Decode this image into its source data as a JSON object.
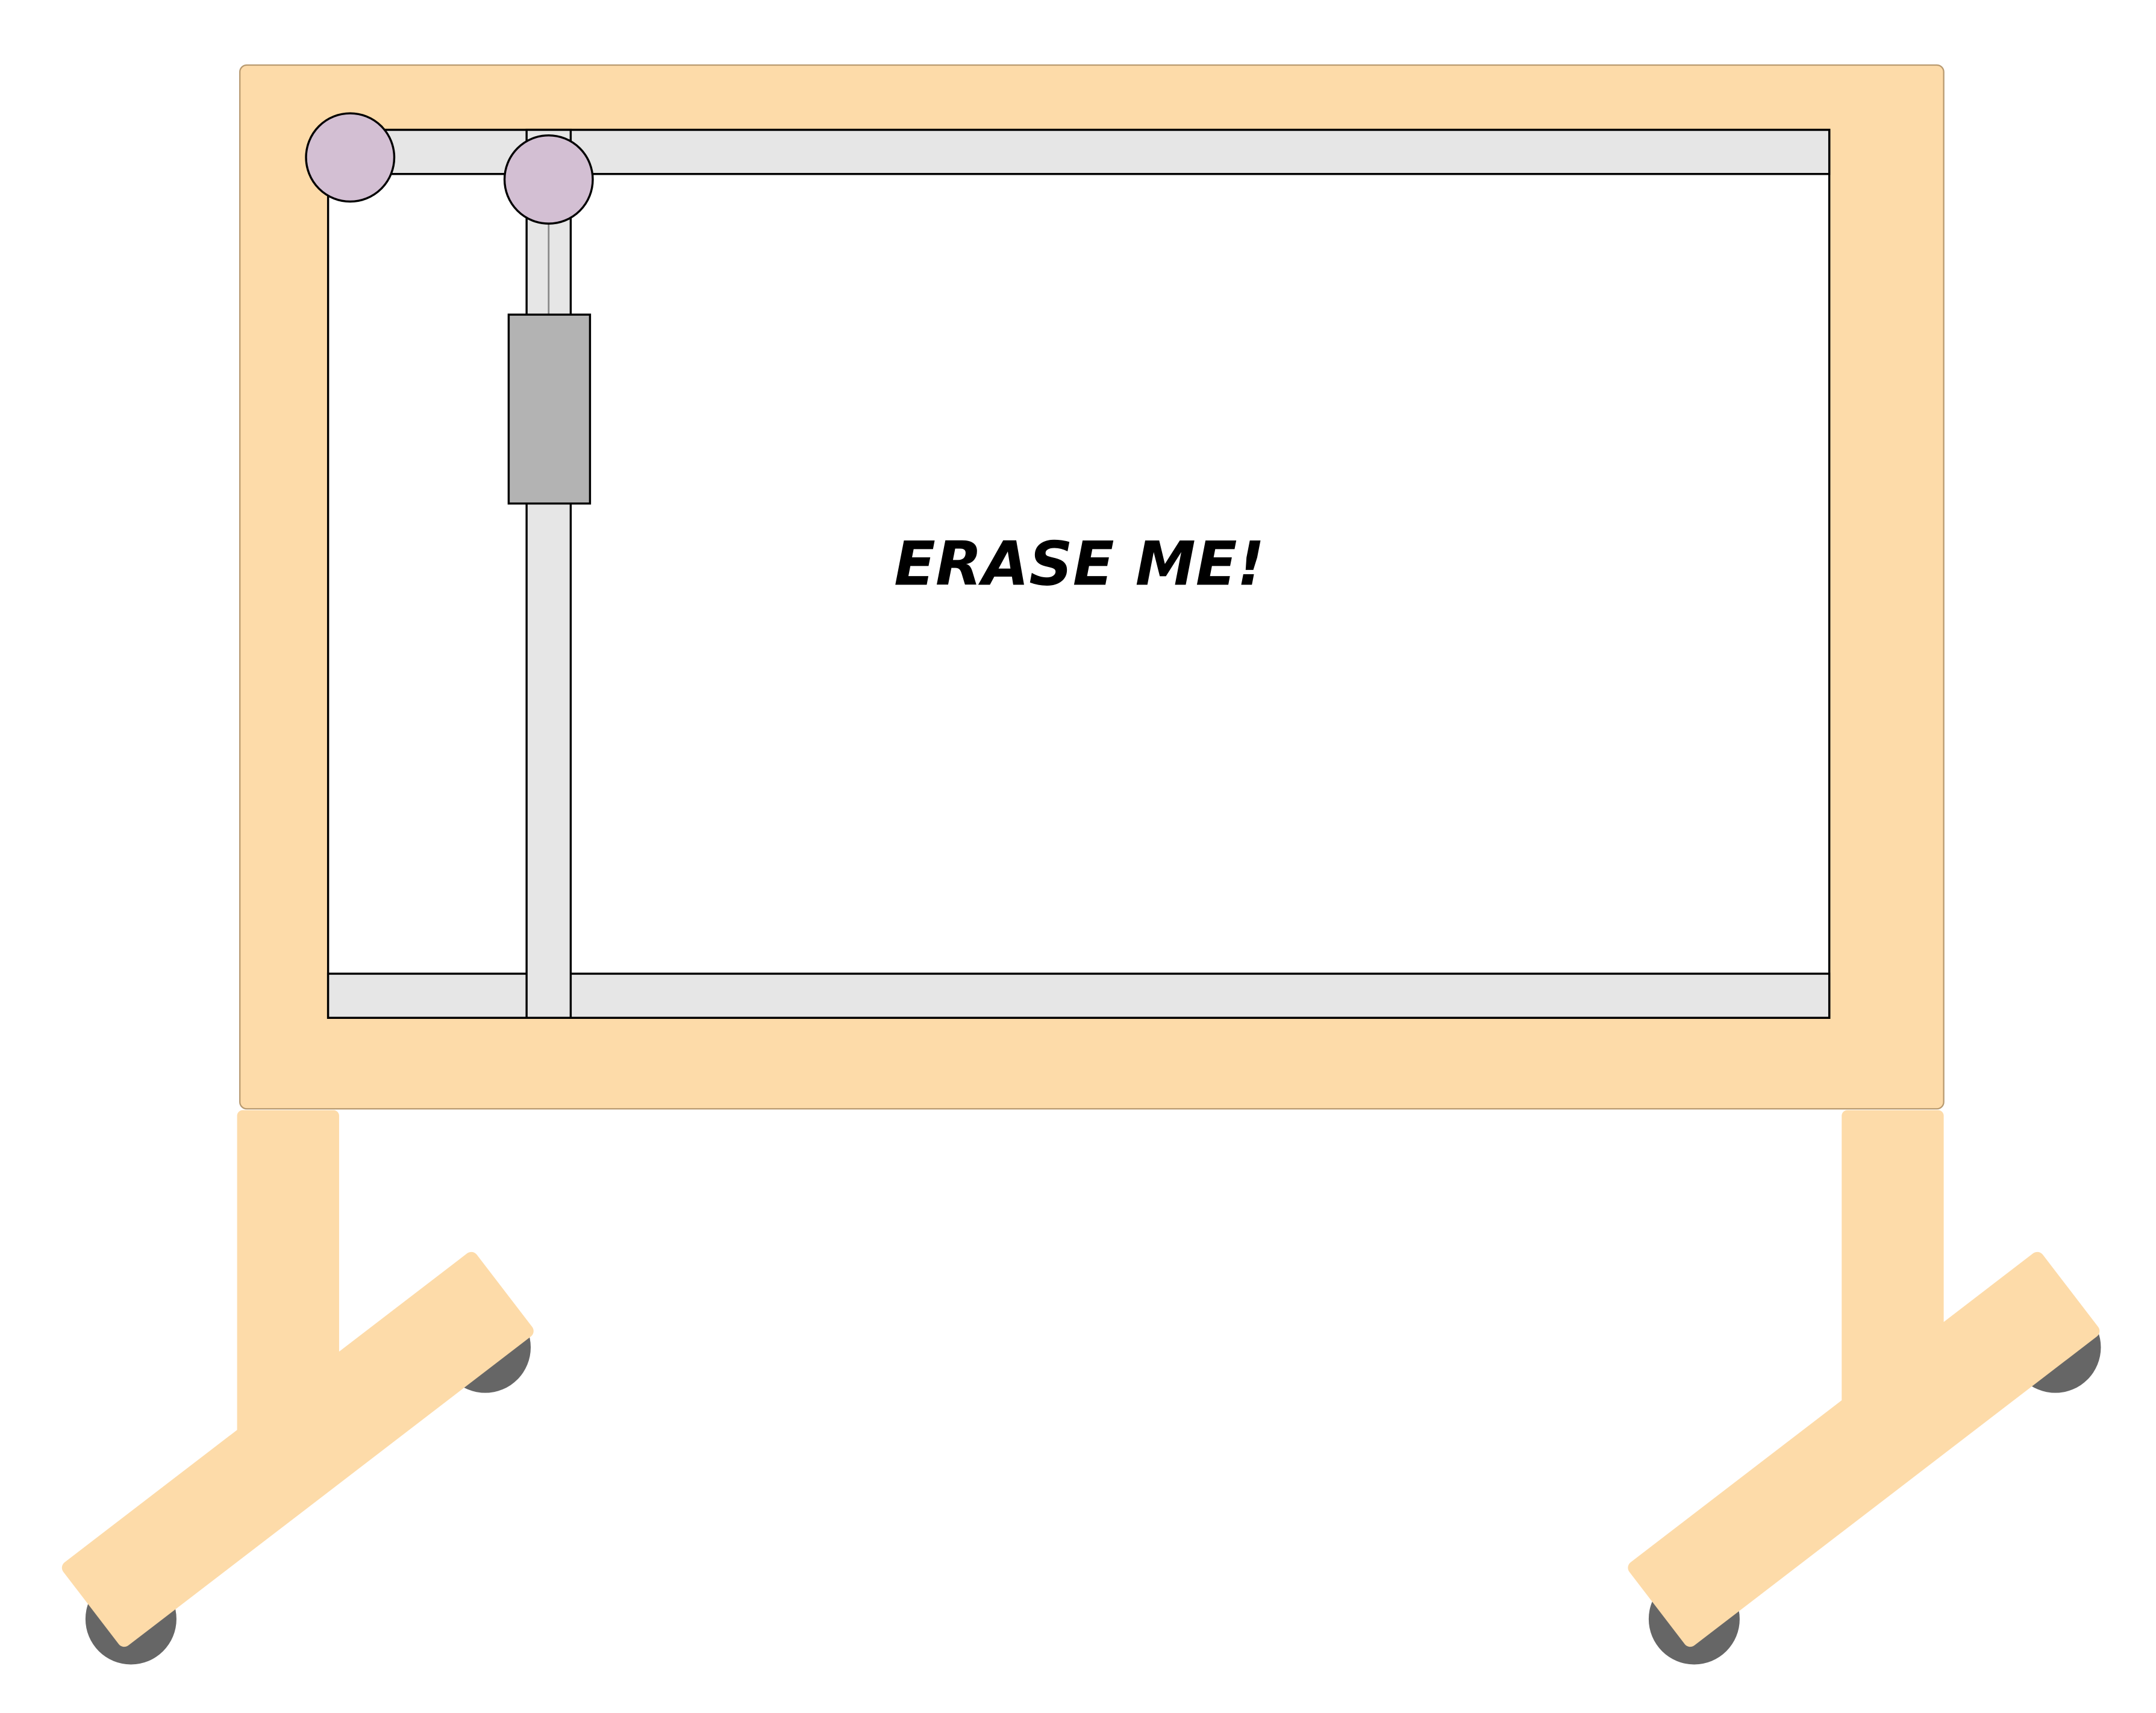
{
  "whiteboard": {
    "message": "ERASE ME!"
  },
  "colors": {
    "frame": "#FDDBA9",
    "frame_edge": "#B89A70",
    "board": "#FFFFFF",
    "rail": "#E6E6E6",
    "carriage": "#B3B3B3",
    "pulley": "#D3BFD3",
    "wheel": "#666666",
    "outline": "#000000",
    "thread": "#888888"
  },
  "icons": {
    "corner_pulley": "pulley-icon",
    "carriage_pulley": "pulley-icon",
    "eraser_carriage": "eraser-icon",
    "wheels": "caster-wheel-icon"
  }
}
